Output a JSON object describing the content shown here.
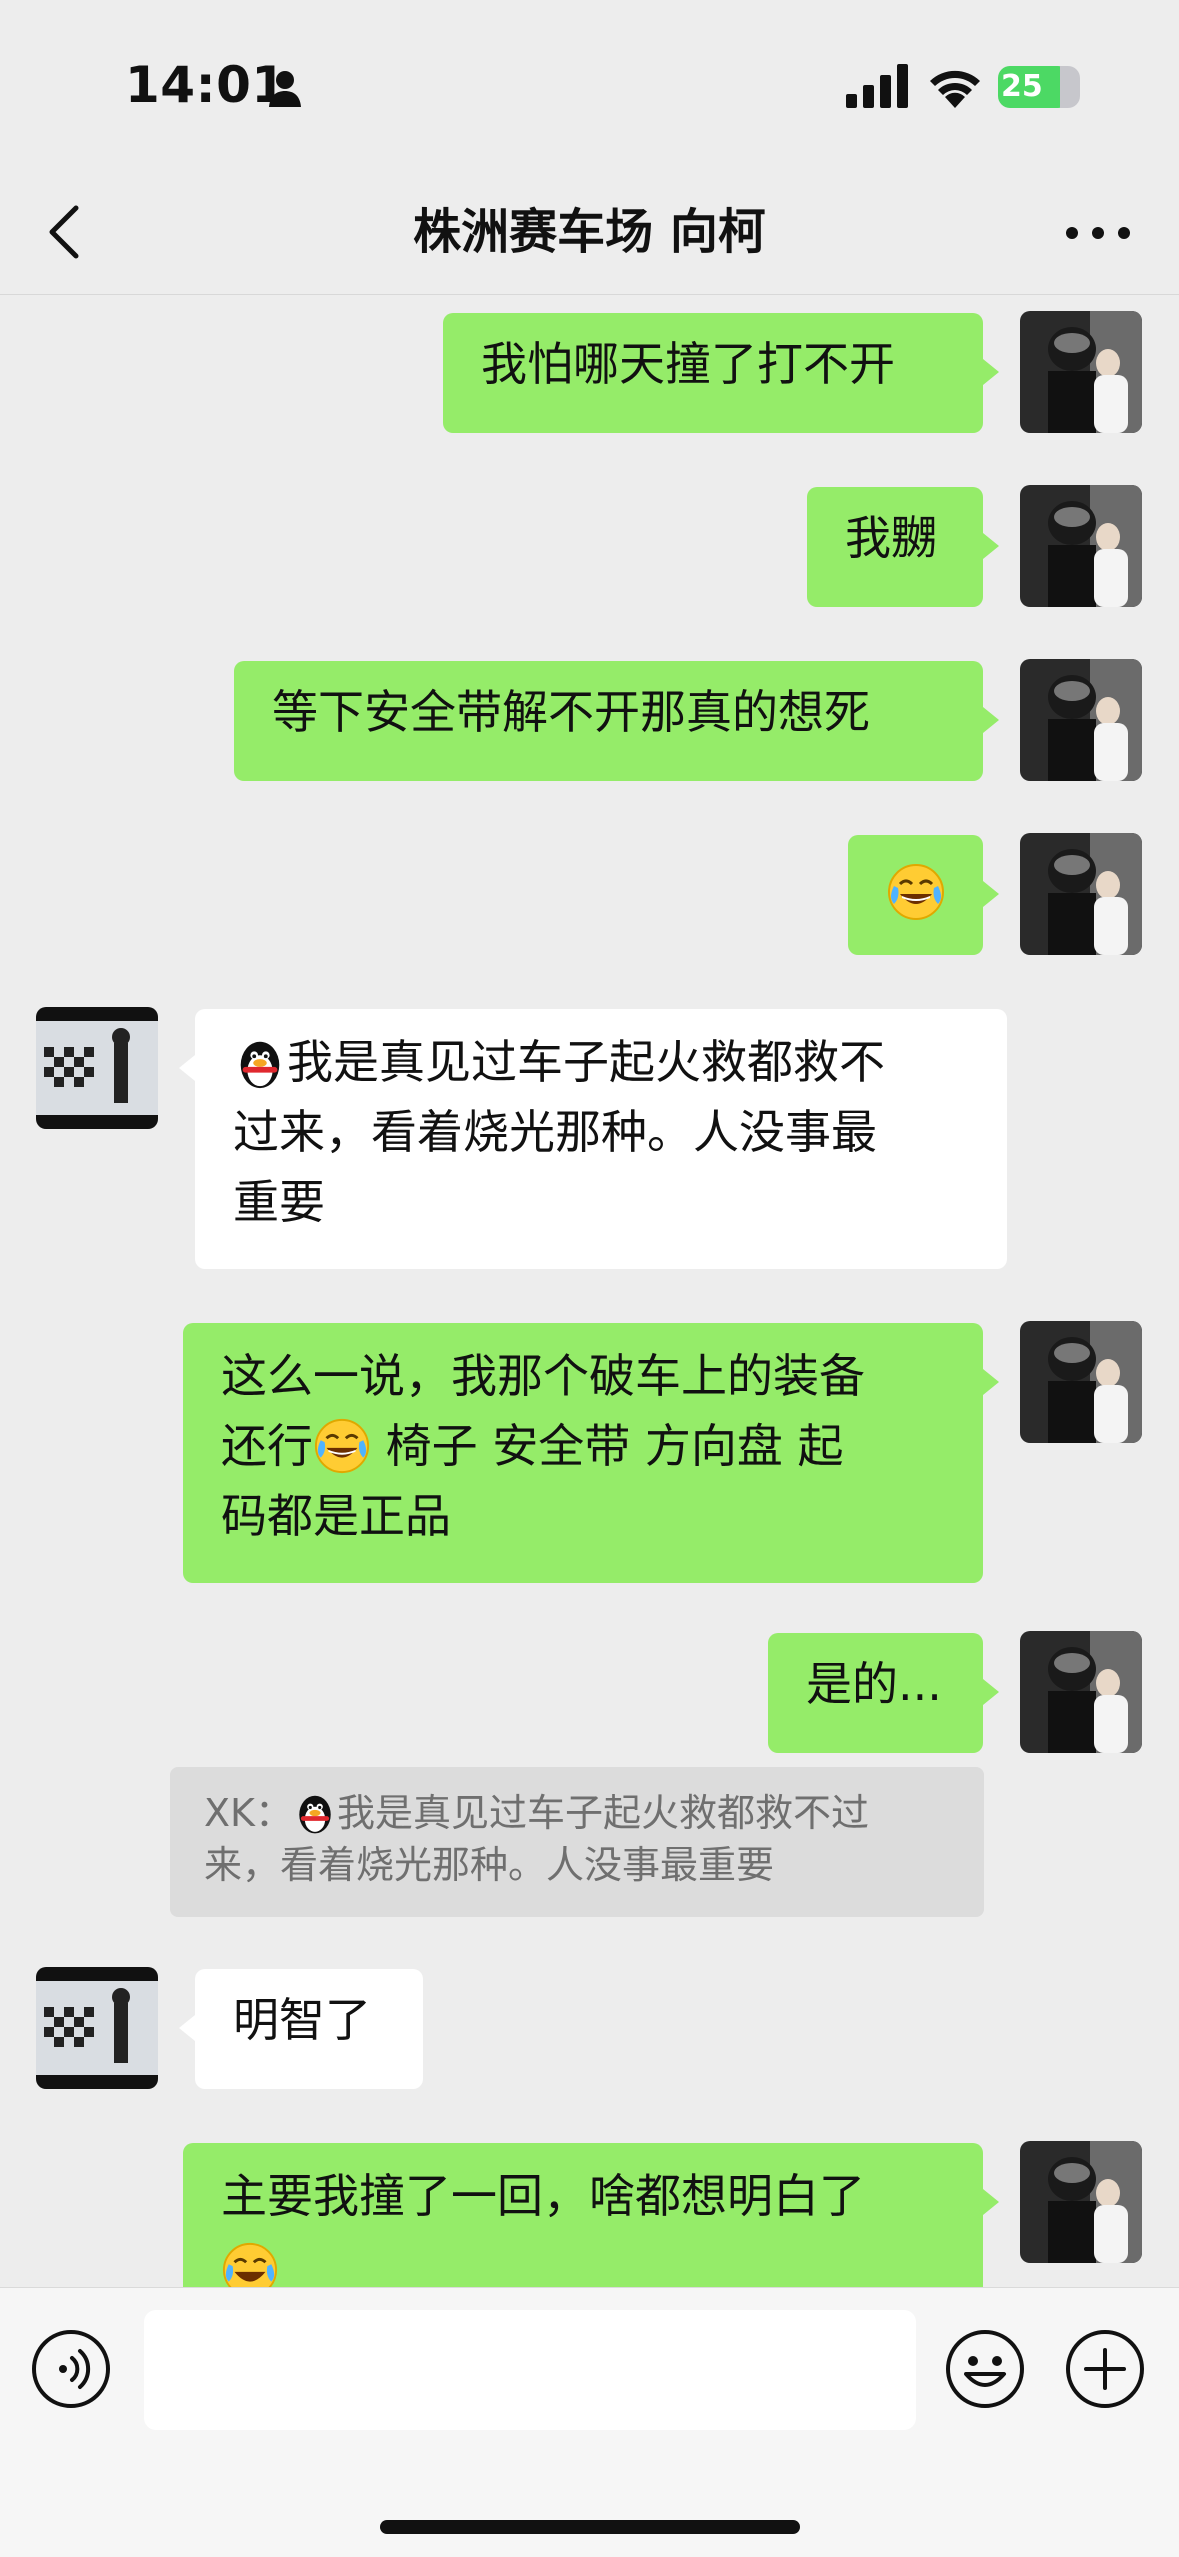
{
  "status_bar": {
    "time": "14:01",
    "battery": "25"
  },
  "header": {
    "title": "株洲赛车场 向柯"
  },
  "messages": [
    {
      "from": "me",
      "text": "我怕哪天撞了打不开"
    },
    {
      "from": "me",
      "text": "我嬲"
    },
    {
      "from": "me",
      "text": "等下安全带解不开那真的想死"
    },
    {
      "from": "me",
      "emoji": "laugh-cry-emoji"
    },
    {
      "from": "them",
      "line1": "我是真见过车子起火救都救不",
      "line2": "过来，看着烧光那种。人没事最",
      "line3": "重要"
    },
    {
      "from": "me",
      "line1": "这么一说，我那个破车上的装备",
      "line2a": "还行",
      "line2b": " 椅子 安全带 方向盘 起",
      "line3": "码都是正品"
    },
    {
      "from": "me",
      "text": "是的..."
    },
    {
      "from": "me",
      "text": "主要我撞了一回，啥都想明白了"
    }
  ],
  "quote": {
    "prefix": "XK：",
    "line1": "我是真见过车子起火救都救不过",
    "line2": "来，看着烧光那种。人没事最重要"
  },
  "reply": {
    "text": "明智了"
  },
  "colors": {
    "background": "#ededed",
    "my_bubble": "#95ec69",
    "their_bubble": "#ffffff"
  }
}
